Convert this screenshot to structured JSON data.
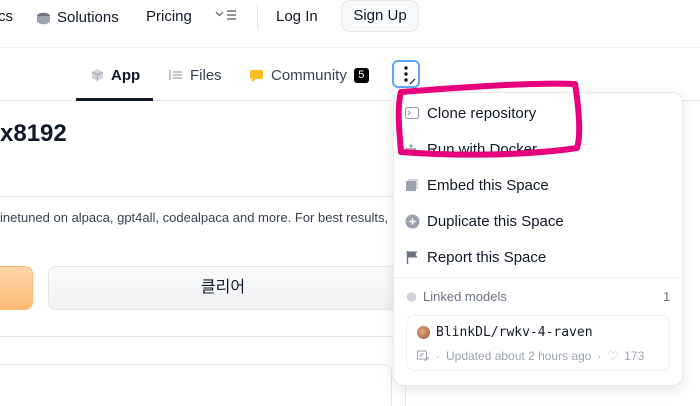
{
  "topnav": {
    "frag_left": "cs",
    "solutions": "Solutions",
    "pricing": "Pricing",
    "more_icon": "chevron-list-icon",
    "login": "Log In",
    "signup": "Sign Up"
  },
  "tabs": [
    {
      "label": "App",
      "icon": "cube-icon",
      "active": true
    },
    {
      "label": "Files",
      "icon": "files-icon"
    },
    {
      "label": "Community",
      "icon": "community-icon",
      "badge": "5"
    }
  ],
  "page": {
    "title_fragment": "x8192",
    "description": "inetuned on alpaca, gpt4all, codealpaca and more. For best results,",
    "clear_button": "클리어"
  },
  "menu": {
    "items": [
      {
        "label": "Clone repository",
        "icon": "terminal-icon"
      },
      {
        "label": "Run with Docker",
        "icon": "docker-icon"
      },
      {
        "label": "Embed this Space",
        "icon": "embed-icon"
      },
      {
        "label": "Duplicate this Space",
        "icon": "duplicate-icon"
      },
      {
        "label": "Report this Space",
        "icon": "flag-icon"
      }
    ],
    "linked_models": {
      "heading": "Linked models",
      "count": "1",
      "model": {
        "name": "BlinkDL/rwkv-4-raven",
        "updated": "Updated about 2 hours ago",
        "likes": "173"
      }
    }
  },
  "colors": {
    "annotation": "#e6007e",
    "focus_ring": "#60a5fa",
    "orange": "#fdba74"
  }
}
